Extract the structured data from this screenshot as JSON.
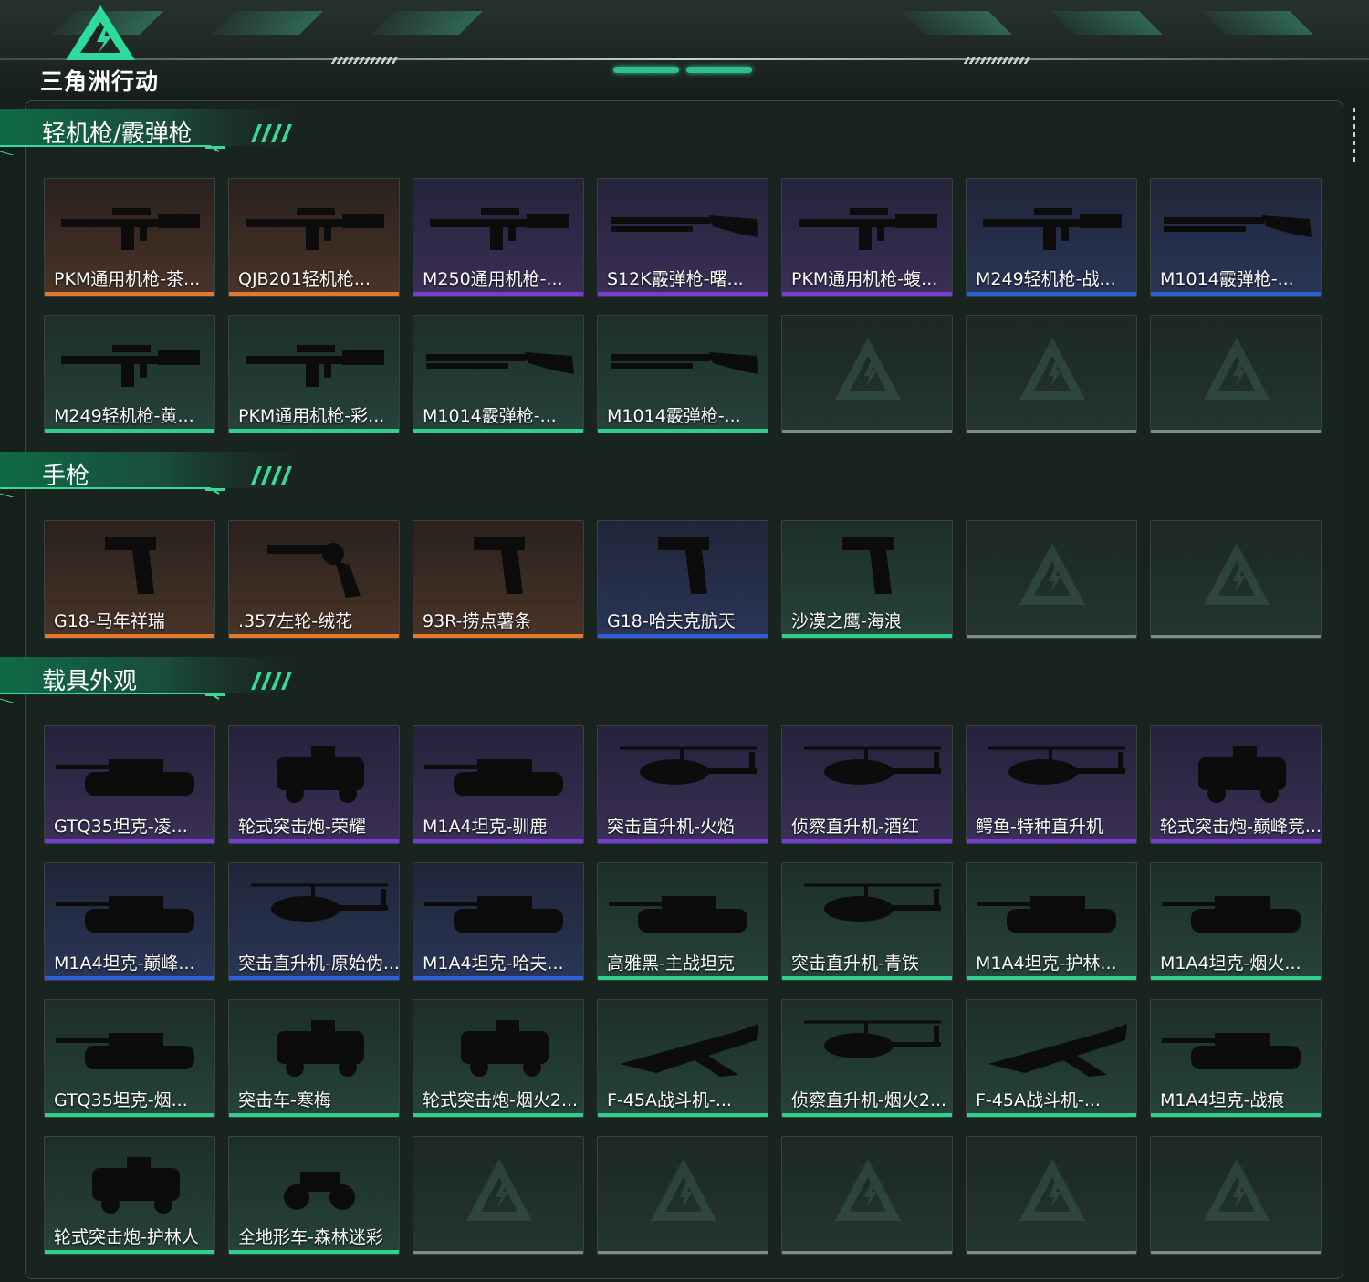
{
  "app": {
    "logo_text": "三角洲行动"
  },
  "colors": {
    "orange": "#e07a2a",
    "purple": "#7a3ad8",
    "blue": "#2f5fd8",
    "green": "#2fcf8c",
    "empty": "#808a86",
    "accent": "#2fcf8c"
  },
  "sections": [
    {
      "title": "轻机枪/霰弹枪",
      "items": [
        {
          "label": "PKM通用机枪-茶...",
          "rarity": "orange",
          "icon": "machine-gun-icon"
        },
        {
          "label": "QJB201轻机枪...",
          "rarity": "orange",
          "icon": "machine-gun-icon"
        },
        {
          "label": "M250通用机枪-...",
          "rarity": "purple",
          "icon": "machine-gun-icon"
        },
        {
          "label": "S12K霰弹枪-曙...",
          "rarity": "purple",
          "icon": "shotgun-icon"
        },
        {
          "label": "PKM通用机枪-蝮...",
          "rarity": "purple",
          "icon": "machine-gun-icon"
        },
        {
          "label": "M249轻机枪-战...",
          "rarity": "blue",
          "icon": "machine-gun-icon"
        },
        {
          "label": "M1014霰弹枪-...",
          "rarity": "blue",
          "icon": "shotgun-icon"
        },
        {
          "label": "M249轻机枪-黄...",
          "rarity": "green",
          "icon": "machine-gun-icon"
        },
        {
          "label": "PKM通用机枪-彩...",
          "rarity": "green",
          "icon": "machine-gun-icon"
        },
        {
          "label": "M1014霰弹枪-...",
          "rarity": "green",
          "icon": "shotgun-icon"
        },
        {
          "label": "M1014霰弹枪-...",
          "rarity": "green",
          "icon": "shotgun-icon"
        },
        {
          "label": "",
          "rarity": "empty",
          "icon": "empty-slot-icon"
        },
        {
          "label": "",
          "rarity": "empty",
          "icon": "empty-slot-icon"
        },
        {
          "label": "",
          "rarity": "empty",
          "icon": "empty-slot-icon"
        }
      ]
    },
    {
      "title": "手枪",
      "items": [
        {
          "label": "G18-马年祥瑞",
          "rarity": "orange",
          "icon": "pistol-icon"
        },
        {
          "label": ".357左轮-绒花",
          "rarity": "orange",
          "icon": "revolver-icon"
        },
        {
          "label": "93R-捞点薯条",
          "rarity": "orange",
          "icon": "pistol-icon"
        },
        {
          "label": "G18-哈夫克航天",
          "rarity": "blue",
          "icon": "pistol-icon"
        },
        {
          "label": "沙漠之鹰-海浪",
          "rarity": "green",
          "icon": "pistol-icon"
        },
        {
          "label": "",
          "rarity": "empty",
          "icon": "empty-slot-icon"
        },
        {
          "label": "",
          "rarity": "empty",
          "icon": "empty-slot-icon"
        }
      ]
    },
    {
      "title": "载具外观",
      "items": [
        {
          "label": "GTQ35坦克-凌...",
          "rarity": "purple",
          "icon": "tank-icon"
        },
        {
          "label": "轮式突击炮-荣耀",
          "rarity": "purple",
          "icon": "armored-car-icon"
        },
        {
          "label": "M1A4坦克-驯鹿",
          "rarity": "purple",
          "icon": "tank-icon"
        },
        {
          "label": "突击直升机-火焰",
          "rarity": "purple",
          "icon": "helicopter-icon"
        },
        {
          "label": "侦察直升机-酒红",
          "rarity": "purple",
          "icon": "helicopter-icon"
        },
        {
          "label": "鳄鱼-特种直升机",
          "rarity": "purple",
          "icon": "helicopter-icon"
        },
        {
          "label": "轮式突击炮-巅峰竞...",
          "rarity": "purple",
          "icon": "armored-car-icon"
        },
        {
          "label": "M1A4坦克-巅峰...",
          "rarity": "blue",
          "icon": "tank-icon"
        },
        {
          "label": "突击直升机-原始伪...",
          "rarity": "blue",
          "icon": "helicopter-icon"
        },
        {
          "label": "M1A4坦克-哈夫...",
          "rarity": "blue",
          "icon": "tank-icon"
        },
        {
          "label": "高雅黑-主战坦克",
          "rarity": "green",
          "icon": "tank-icon"
        },
        {
          "label": "突击直升机-青铁",
          "rarity": "green",
          "icon": "helicopter-icon"
        },
        {
          "label": "M1A4坦克-护林...",
          "rarity": "green",
          "icon": "tank-icon"
        },
        {
          "label": "M1A4坦克-烟火...",
          "rarity": "green",
          "icon": "tank-icon"
        },
        {
          "label": "GTQ35坦克-烟...",
          "rarity": "green",
          "icon": "tank-icon"
        },
        {
          "label": "突击车-寒梅",
          "rarity": "green",
          "icon": "armored-car-icon"
        },
        {
          "label": "轮式突击炮-烟火2...",
          "rarity": "green",
          "icon": "armored-car-icon"
        },
        {
          "label": "F-45A战斗机-...",
          "rarity": "green",
          "icon": "jet-icon"
        },
        {
          "label": "侦察直升机-烟火2...",
          "rarity": "green",
          "icon": "helicopter-icon"
        },
        {
          "label": "F-45A战斗机-...",
          "rarity": "green",
          "icon": "jet-icon"
        },
        {
          "label": "M1A4坦克-战痕",
          "rarity": "green",
          "icon": "tank-icon"
        },
        {
          "label": "轮式突击炮-护林人",
          "rarity": "green",
          "icon": "armored-car-icon"
        },
        {
          "label": "全地形车-森林迷彩",
          "rarity": "green",
          "icon": "atv-icon"
        },
        {
          "label": "",
          "rarity": "empty",
          "icon": "empty-slot-icon"
        },
        {
          "label": "",
          "rarity": "empty",
          "icon": "empty-slot-icon"
        },
        {
          "label": "",
          "rarity": "empty",
          "icon": "empty-slot-icon"
        },
        {
          "label": "",
          "rarity": "empty",
          "icon": "empty-slot-icon"
        },
        {
          "label": "",
          "rarity": "empty",
          "icon": "empty-slot-icon"
        }
      ]
    }
  ]
}
